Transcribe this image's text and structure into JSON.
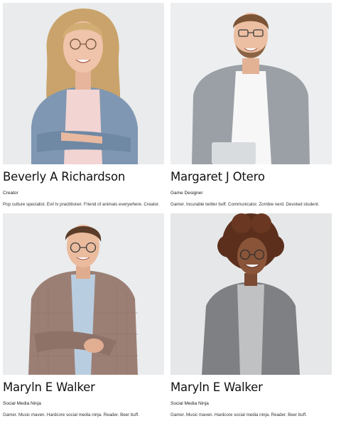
{
  "team": {
    "members": [
      {
        "name": "Beverly A Richardson",
        "role": "Creator",
        "bio": "Pop culture specialist. Evil tv practitioner. Friend of animals everywhere. Creator."
      },
      {
        "name": "Margaret J Otero",
        "role": "Game Designer",
        "bio": "Gamer. Incurable twitter buff. Communicator. Zombie nerd. Devoted student."
      },
      {
        "name": "Maryln E Walker",
        "role": "Social Media Ninja",
        "bio": "Gamer. Music maven. Hardcore social media ninja. Reader. Beer buff."
      },
      {
        "name": "Maryln E Walker",
        "role": "Social Media Ninja",
        "bio": "Gamer. Music maven. Hardcore social media ninja. Reader. Beer buff."
      }
    ]
  }
}
